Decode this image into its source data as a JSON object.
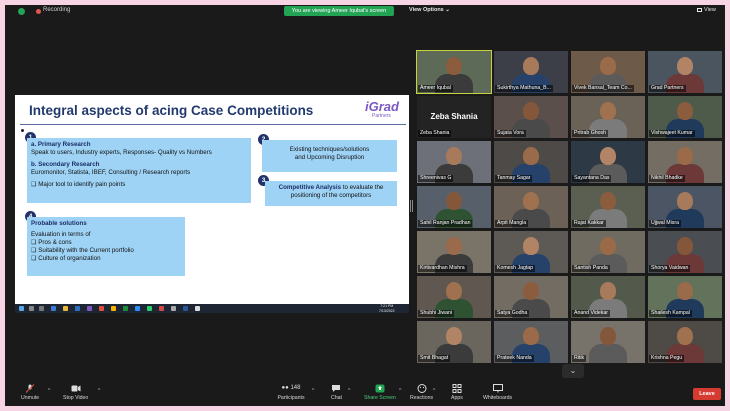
{
  "topbar": {
    "recording": "Recording",
    "viewing_banner": "You are viewing Ameer Iqubal's screen",
    "view_options": "View Options ⌄",
    "view": "View"
  },
  "slide": {
    "title": "Integral aspects of acing Case Competitions",
    "logo": "iGrad",
    "logo_sub": "Partners",
    "box1": {
      "num": "1",
      "h1": "a. Primary Research",
      "t1": "Speak to users, Industry experts, Responses- Quality vs Numbers",
      "h2": "b. Secondary Research",
      "t2": "Euromonitor, Statista, IBEF, Consulting / Research reports",
      "t3": "❑  Major tool to identify pain points"
    },
    "box2": {
      "num": "2",
      "l1": "Existing techniques/solutions",
      "l2": "and Upcoming Disruption"
    },
    "box3": {
      "num": "3",
      "h": "Competitive Analysis",
      "t": " to evaluate the positioning of the competitors"
    },
    "box4": {
      "num": "4",
      "h": "Probable solutions",
      "t1": "Evaluation in terms of",
      "b1": "❑  Pros & cons",
      "b2": "❑  Suitability with the Current portfolio",
      "b3": "❑  Culture of organization"
    },
    "taskbar_time": "7:21 PM",
    "taskbar_date": "7/13/2022"
  },
  "participants": [
    {
      "name": "Ameer Iqubal",
      "hl": true
    },
    {
      "name": "Sukirthya Mathuna_B..."
    },
    {
      "name": "Vivek Bansal_Team Co..."
    },
    {
      "name": "Grad Partners"
    },
    {
      "name": "Zeba Shania",
      "big": "Zeba Shania"
    },
    {
      "name": "Sujata Vora"
    },
    {
      "name": "Pritrab Ghosh"
    },
    {
      "name": "Vishwajeet Kumar"
    },
    {
      "name": "Shreenivas G"
    },
    {
      "name": "Tanmay Sagar"
    },
    {
      "name": "Sayantana Das"
    },
    {
      "name": "Nikhil Bhadke"
    },
    {
      "name": "Sahil Ranjan Pradhan"
    },
    {
      "name": "Arpit Mangla"
    },
    {
      "name": "Rajat Kakkar"
    },
    {
      "name": "Ujjwal Misra"
    },
    {
      "name": "Kirtivardhan Mishra"
    },
    {
      "name": "Komesh Jagtap"
    },
    {
      "name": "Santish Panda"
    },
    {
      "name": "Shorya Vaidwan"
    },
    {
      "name": "Shubhi Jiwani"
    },
    {
      "name": "Satya Godha"
    },
    {
      "name": "Anand Videkar"
    },
    {
      "name": "Shailesh Kampal"
    },
    {
      "name": "Smit Bhagat"
    },
    {
      "name": "Prateek Nanda"
    },
    {
      "name": "Ritik"
    },
    {
      "name": "Krishna Pegu"
    }
  ],
  "more": "⌄",
  "controls": {
    "unmute": "Unmute",
    "stop_video": "Stop Video",
    "participants": "Participants",
    "participants_count": "148",
    "chat": "Chat",
    "share_screen": "Share Screen",
    "reactions": "Reactions",
    "apps": "Apps",
    "whiteboards": "Whiteboards",
    "leave": "Leave"
  },
  "colors": {
    "accent_green": "#23a455",
    "leave_red": "#d63b32",
    "slide_box": "#9ed3f5",
    "slide_title": "#223a6e"
  }
}
